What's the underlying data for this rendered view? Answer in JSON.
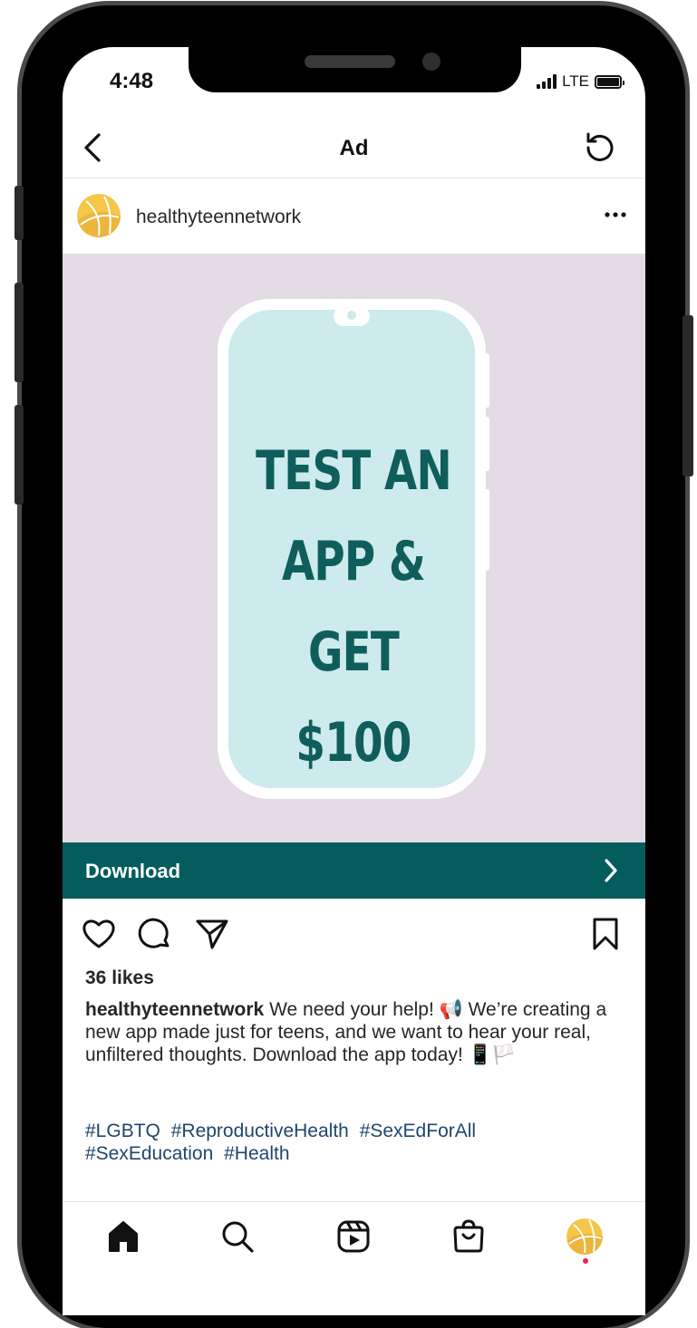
{
  "status_bar": {
    "time": "4:48",
    "network": "LTE"
  },
  "nav": {
    "title": "Ad"
  },
  "post": {
    "username": "healthyteennetwork",
    "image": {
      "headline_lines": [
        "TEST AN",
        "APP &",
        "GET $100"
      ]
    },
    "cta_label": "Download",
    "likes": "36 likes",
    "caption_username": "healthyteennetwork",
    "caption_text": "We need your help! 📢 We’re creating a new app made just for teens, and we want to hear your real, unfiltered thoughts. Download the app today! 📱🏳️",
    "hashtags": [
      "#LGBTQ",
      "#ReproductiveHealth",
      "#SexEdForAll",
      "#SexEducation",
      "#Health"
    ]
  },
  "colors": {
    "cta_background": "#045c5c",
    "image_background": "#e3dce5",
    "art_phone_screen": "#cdeaec",
    "headline": "#0f5e5b",
    "hashtag": "#20466e",
    "notification_dot": "#ed2553"
  },
  "icons": {
    "nav": [
      "back-icon",
      "refresh-icon"
    ],
    "post_header": [
      "avatar",
      "more-icon"
    ],
    "actions": [
      "heart-icon",
      "comment-icon",
      "share-icon",
      "bookmark-icon"
    ],
    "tabbar": [
      "home-icon",
      "search-icon",
      "reels-icon",
      "shop-icon",
      "profile-icon"
    ]
  }
}
